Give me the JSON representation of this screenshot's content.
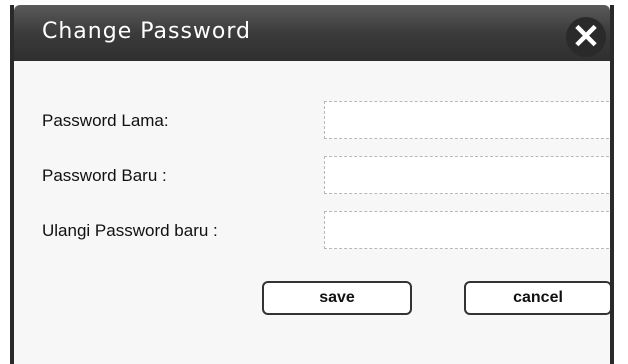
{
  "dialog": {
    "title": "Change Password",
    "close_symbol": "✕",
    "fields": [
      {
        "label": "Password Lama:",
        "value": ""
      },
      {
        "label": "Password Baru :",
        "value": ""
      },
      {
        "label": "Ulangi Password baru :",
        "value": ""
      }
    ],
    "buttons": {
      "save": "save",
      "cancel": "cancel"
    }
  },
  "colors": {
    "titlebar": "#3b3b3b",
    "frame": "#2a2a2a",
    "text": "#111111"
  },
  "icons": {
    "close": "close-icon"
  }
}
